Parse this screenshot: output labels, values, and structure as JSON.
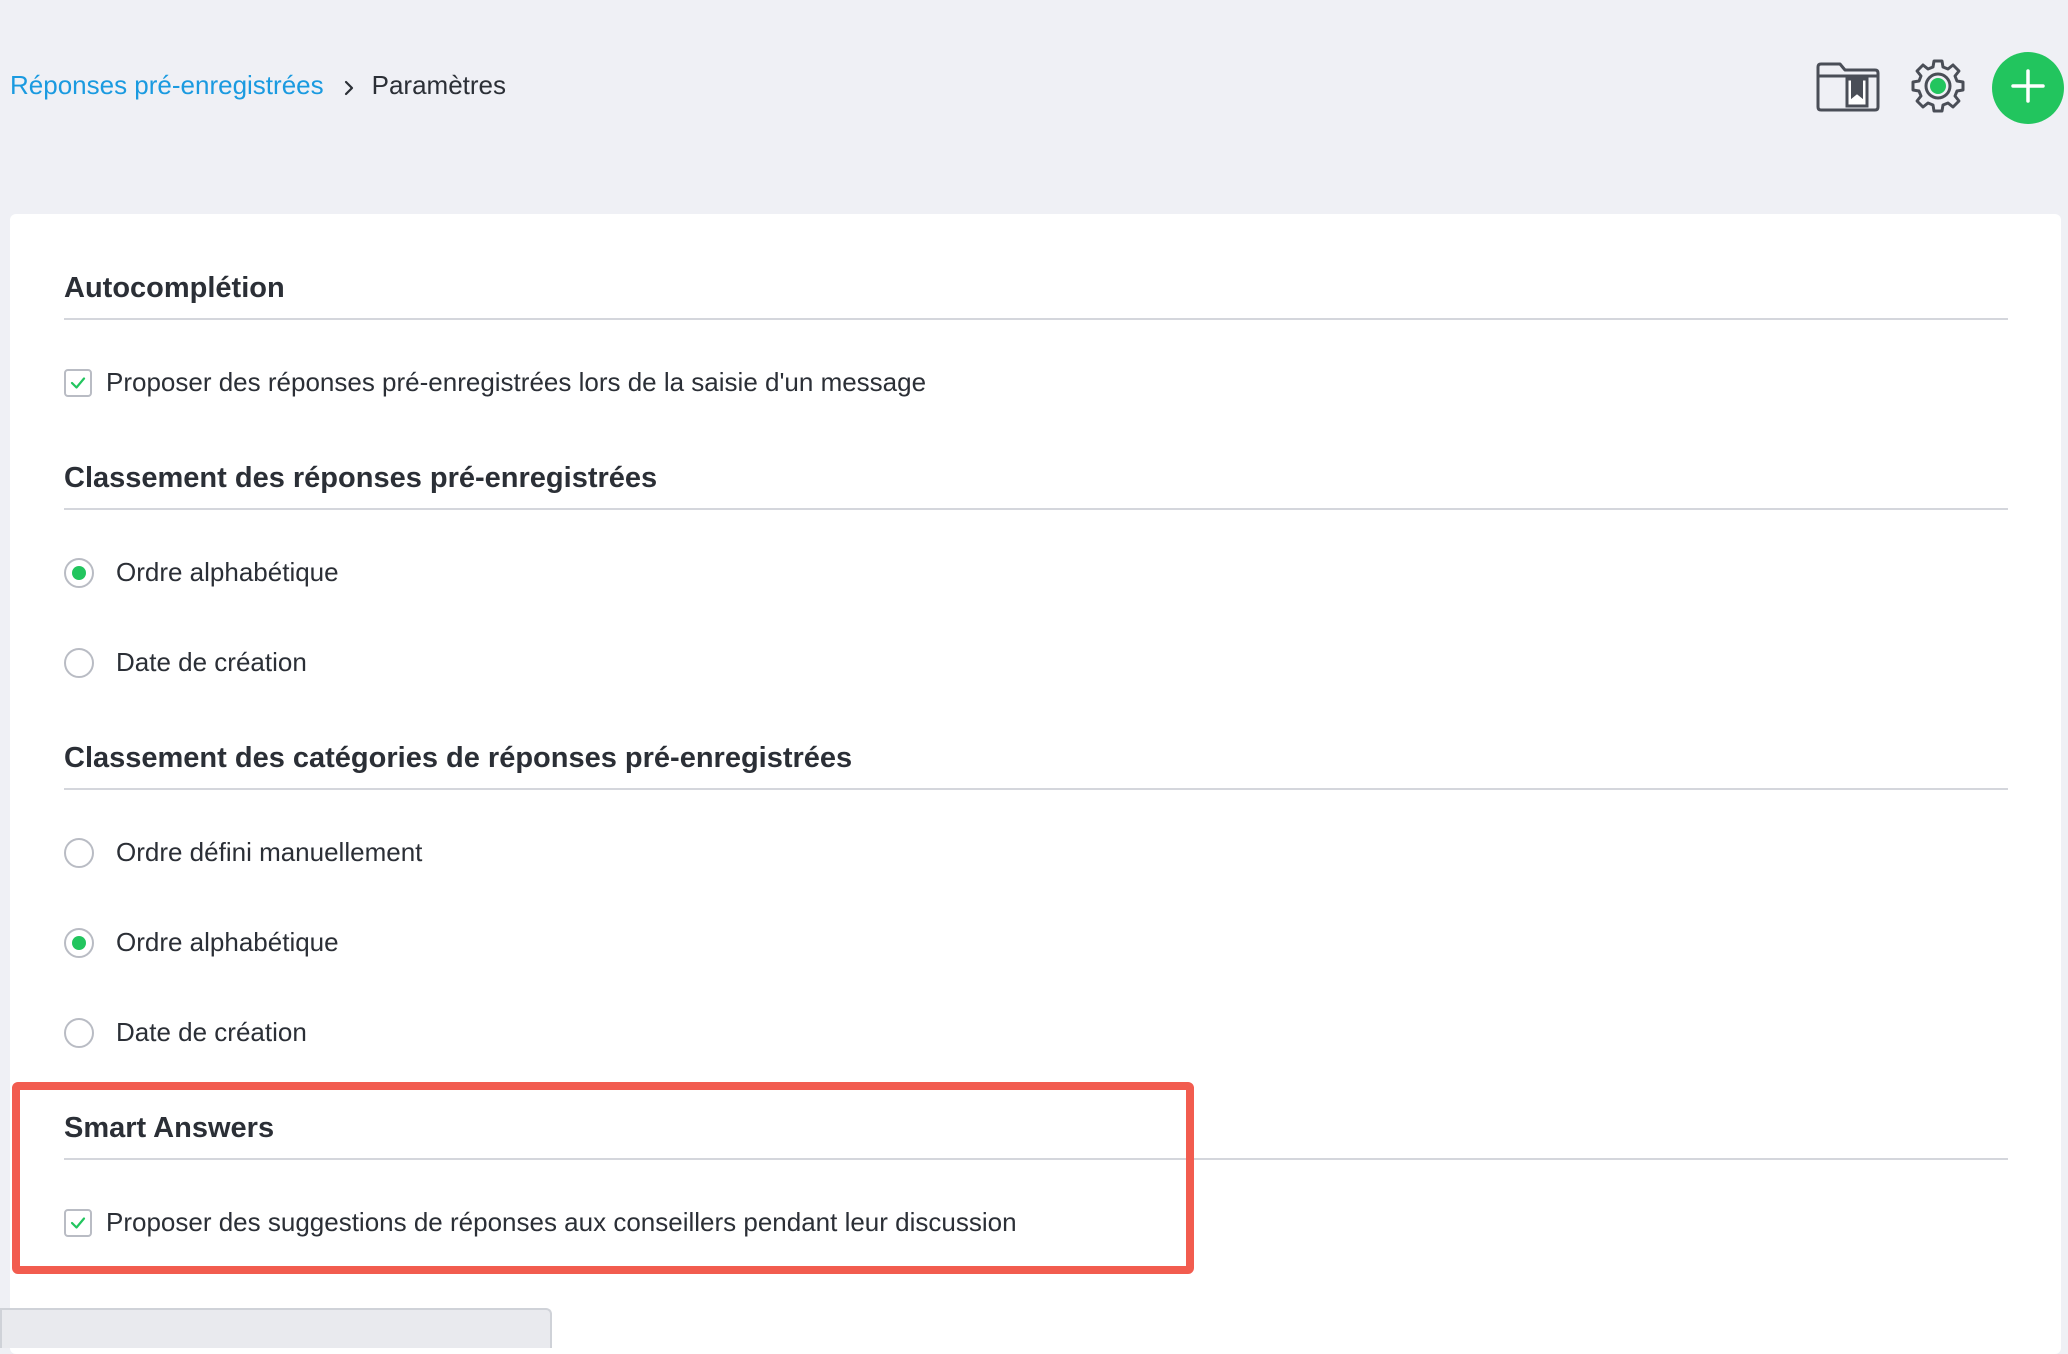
{
  "breadcrumb": {
    "parent": "Réponses pré-enregistrées",
    "current": "Paramètres"
  },
  "toolbar": {
    "library_icon": "folder-bookmark-icon",
    "settings_icon": "gear-icon",
    "add_icon": "plus-icon",
    "accent_color": "#22c55e"
  },
  "sections": {
    "autocompletion": {
      "title": "Autocomplétion",
      "option": {
        "label": "Proposer des réponses pré-enregistrées lors de la saisie d'un message",
        "checked": true
      }
    },
    "answers_sort": {
      "title": "Classement des réponses pré-enregistrées",
      "options": [
        {
          "label": "Ordre alphabétique",
          "selected": true
        },
        {
          "label": "Date de création",
          "selected": false
        }
      ]
    },
    "categories_sort": {
      "title": "Classement des catégories de réponses pré-enregistrées",
      "options": [
        {
          "label": "Ordre défini manuellement",
          "selected": false
        },
        {
          "label": "Ordre alphabétique",
          "selected": true
        },
        {
          "label": "Date de création",
          "selected": false
        }
      ]
    },
    "smart_answers": {
      "title": "Smart Answers",
      "option": {
        "label": "Proposer des suggestions de réponses aux conseillers pendant leur discussion",
        "checked": true
      }
    }
  },
  "highlight_color": "#f25c4f"
}
